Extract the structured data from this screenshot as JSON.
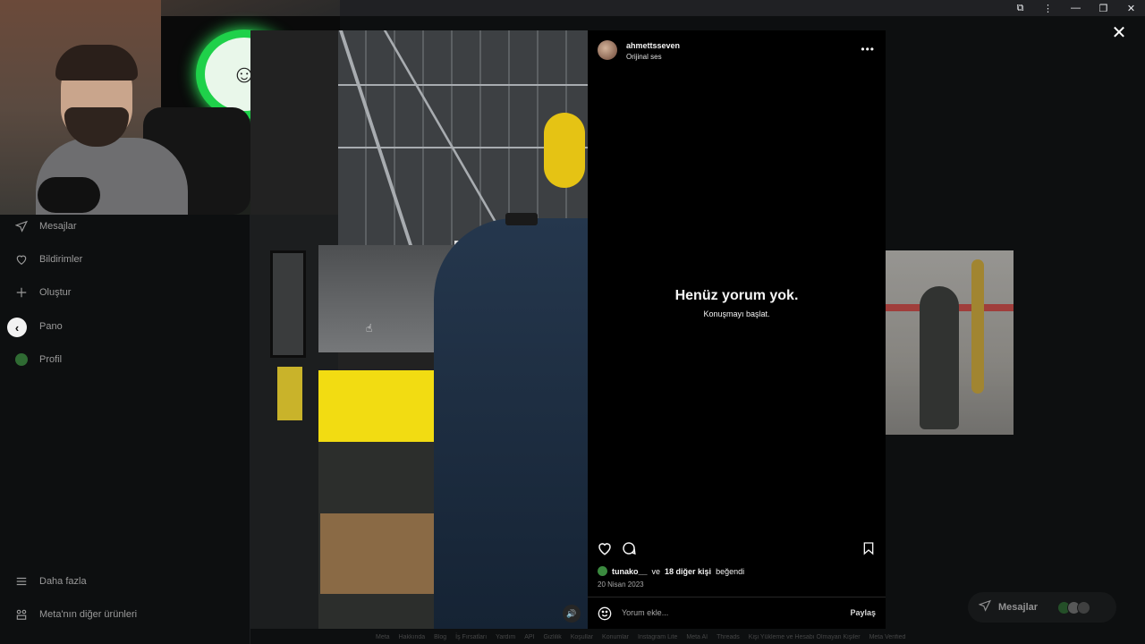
{
  "window": {
    "controls": [
      "⧉",
      "⋮",
      "—",
      "❐",
      "✕"
    ]
  },
  "sidebar": {
    "items": [
      {
        "label": "Mesajlar",
        "icon": "send-icon"
      },
      {
        "label": "Bildirimler",
        "icon": "heart-icon"
      },
      {
        "label": "Oluştur",
        "icon": "plus-icon"
      },
      {
        "label": "Pano",
        "icon": "dashboard-icon"
      },
      {
        "label": "Profil",
        "icon": "profile-avatar-icon"
      }
    ],
    "bottom": [
      {
        "label": "Daha fazla",
        "icon": "hamburger-icon"
      },
      {
        "label": "Meta'nın diğer ürünleri",
        "icon": "grid-icon"
      }
    ]
  },
  "post": {
    "username": "ahmettsseven",
    "audio": "Orijinal ses",
    "empty_title": "Henüz yorum yok.",
    "empty_subtitle": "Konuşmayı başlat.",
    "likes": {
      "user": "tunako__",
      "middle": "ve",
      "others": "18 diğer kişi",
      "suffix": "beğendi"
    },
    "date": "20 Nisan 2023",
    "comment_placeholder": "Yorum ekle...",
    "share": "Paylaş"
  },
  "messages_pill": {
    "label": "Mesajlar"
  },
  "footer": [
    "Meta",
    "Hakkında",
    "Blog",
    "İş Fırsatları",
    "Yardım",
    "API",
    "Gizlilik",
    "Koşullar",
    "Konumlar",
    "Instagram Lite",
    "Meta AI",
    "Threads",
    "Kişi Yükleme ve Hesabı Olmayan Kişiler",
    "Meta Verified"
  ],
  "colors": {
    "accent_green": "#1fd14a",
    "panel_bg": "#000000",
    "page_bg": "#0d0f10"
  }
}
